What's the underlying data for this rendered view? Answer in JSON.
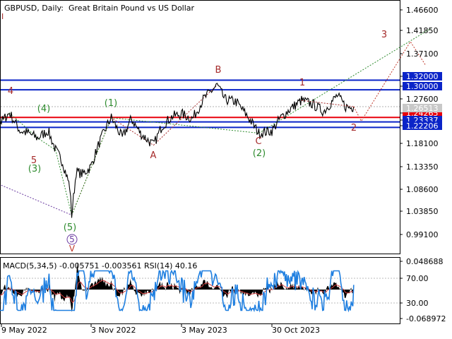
{
  "header": {
    "symbol": "GBPUSD, Daily:",
    "description": "Great Britain Pound vs US Dollar",
    "corner_mark": "I"
  },
  "price_axis": {
    "ticks": [
      "1.46600",
      "1.41850",
      "1.37100",
      "1.32000",
      "1.30000",
      "1.27600",
      "1.24265",
      "1.23337",
      "1.22206",
      "1.18100",
      "1.13350",
      "1.08600",
      "1.03850",
      "0.99100"
    ],
    "highlighted": [
      "1.32000",
      "1.30000",
      "1.24265",
      "1.23337",
      "1.22206"
    ],
    "current_price": "1.26513"
  },
  "indicator": {
    "label": "MACD(5,34,5) -0.005751 -0.003561 RSI(14) 40.16",
    "right_ticks": [
      "0.048688",
      "70.00",
      "30.00",
      "-0.068972"
    ]
  },
  "time_axis": {
    "labels": [
      "9 May 2022",
      "3 Nov 2022",
      "3 May 2023",
      "30 Oct 2023"
    ]
  },
  "wave_labels": [
    {
      "id": "w4-main",
      "text": "4"
    },
    {
      "id": "w4-paren",
      "text": "(4)"
    },
    {
      "id": "w5-small",
      "text": "5"
    },
    {
      "id": "w3-paren",
      "text": "(3)"
    },
    {
      "id": "w5-paren",
      "text": "(5)"
    },
    {
      "id": "w5-circled",
      "text": "5"
    },
    {
      "id": "wV",
      "text": "V"
    },
    {
      "id": "w1-paren",
      "text": "(1)"
    },
    {
      "id": "wA",
      "text": "A"
    },
    {
      "id": "wB",
      "text": "B"
    },
    {
      "id": "wC",
      "text": "C"
    },
    {
      "id": "w2-paren",
      "text": "(2)"
    },
    {
      "id": "w1",
      "text": "1"
    },
    {
      "id": "w2",
      "text": "2"
    },
    {
      "id": "w3",
      "text": "3"
    }
  ],
  "colors": {
    "price_line": "#000000",
    "support_red": "#e8000b",
    "resistance_blue": "#0b24c8",
    "wave_red": "#a52a2a",
    "wave_green": "#2e8b2e",
    "wave_purple": "#6a3aa0",
    "rsi_line": "#1f7fe0",
    "macd_hist": "#000000",
    "axis_label_bg": "#0b24c8"
  },
  "chart_data": {
    "type": "line",
    "title": "GBPUSD, Daily: Great Britain Pound vs US Dollar",
    "x": [
      "9 May 2022",
      "3 Nov 2022",
      "3 May 2023",
      "30 Oct 2023"
    ],
    "y_range": [
      0.991,
      1.466
    ],
    "series": [
      {
        "name": "",
        "points": [
          [
            "2022-03-01",
            1.24
          ],
          [
            "2022-03-20",
            1.26
          ],
          [
            "2022-04-05",
            1.252
          ],
          [
            "2022-04-20",
            1.27
          ],
          [
            "2022-05-05",
            1.235
          ],
          [
            "2022-05-09",
            1.234
          ],
          [
            "2022-05-25",
            1.252
          ],
          [
            "2022-06-15",
            1.215
          ],
          [
            "2022-07-01",
            1.21
          ],
          [
            "2022-07-20",
            1.2
          ],
          [
            "2022-08-10",
            1.215
          ],
          [
            "2022-08-25",
            1.175
          ],
          [
            "2022-09-08",
            1.15
          ],
          [
            "2022-09-22",
            1.1
          ],
          [
            "2022-09-26",
            1.04
          ],
          [
            "2022-10-05",
            1.13
          ],
          [
            "2022-10-18",
            1.125
          ],
          [
            "2022-11-03",
            1.14
          ],
          [
            "2022-11-20",
            1.19
          ],
          [
            "2022-12-05",
            1.225
          ],
          [
            "2022-12-14",
            1.242
          ],
          [
            "2023-01-05",
            1.2
          ],
          [
            "2023-01-23",
            1.24
          ],
          [
            "2023-02-10",
            1.21
          ],
          [
            "2023-03-08",
            1.185
          ],
          [
            "2023-03-25",
            1.225
          ],
          [
            "2023-04-15",
            1.245
          ],
          [
            "2023-05-03",
            1.25
          ],
          [
            "2023-05-25",
            1.24
          ],
          [
            "2023-06-15",
            1.28
          ],
          [
            "2023-07-13",
            1.31
          ],
          [
            "2023-07-28",
            1.28
          ],
          [
            "2023-08-20",
            1.275
          ],
          [
            "2023-09-15",
            1.24
          ],
          [
            "2023-10-04",
            1.21
          ],
          [
            "2023-10-30",
            1.215
          ],
          [
            "2023-11-15",
            1.24
          ],
          [
            "2023-12-05",
            1.26
          ],
          [
            "2023-12-28",
            1.278
          ],
          [
            "2024-01-20",
            1.27
          ],
          [
            "2024-02-10",
            1.255
          ],
          [
            "2024-03-08",
            1.288
          ],
          [
            "2024-03-25",
            1.265
          ],
          [
            "2024-04-05",
            1.263
          ],
          [
            "2024-04-10",
            1.265
          ]
        ]
      },
      {
        "name": "RSI(14)",
        "points": []
      }
    ],
    "levels": [
      {
        "value": 1.32,
        "color": "blue"
      },
      {
        "value": 1.3,
        "color": "blue"
      },
      {
        "value": 1.24265,
        "color": "red"
      },
      {
        "value": 1.23337,
        "color": "blue"
      },
      {
        "value": 1.22206,
        "color": "blue"
      }
    ],
    "projection": {
      "points": [
        [
          "2024-04-10",
          1.265
        ],
        [
          "2024-04-25",
          1.235
        ],
        [
          "2024-08-01",
          1.4
        ],
        [
          "2024-09-01",
          1.35
        ]
      ]
    },
    "indicator_levels": {
      "rsi_upper": 70.0,
      "rsi_lower": 30.0
    },
    "macd_value": -0.005751,
    "macd_signal": -0.003561,
    "rsi_value": 40.16
  }
}
